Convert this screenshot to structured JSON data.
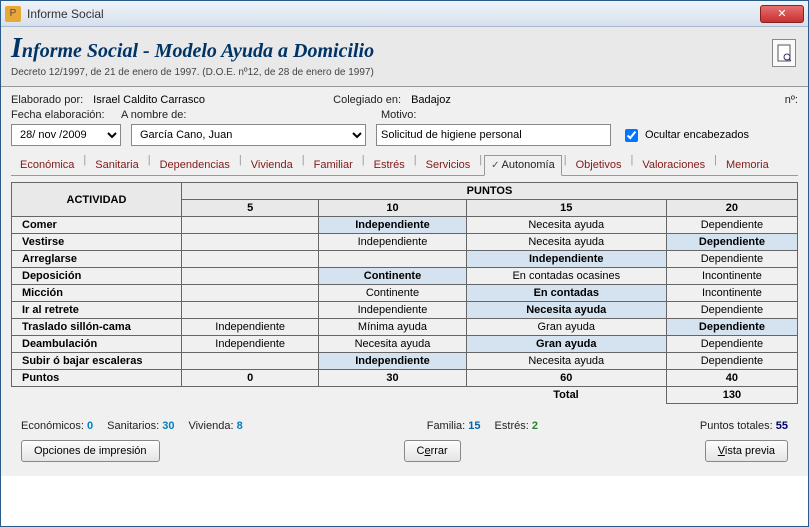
{
  "window": {
    "title": "Informe Social"
  },
  "header": {
    "title": "Informe Social - Modelo Ayuda a Domicilio",
    "subtitle": "Decreto 12/1997, de 21 de enero de 1997. (D.O.E. nº12, de 28 de enero de 1997)"
  },
  "info": {
    "elaborado_lbl": "Elaborado por:",
    "elaborado_val": "Israel Caldito Carrasco",
    "colegiado_lbl": "Colegiado en:",
    "colegiado_val": "Badajoz",
    "num_lbl": "nº:",
    "fecha_lbl": "Fecha elaboración:",
    "fecha_val": "28/ nov /2009",
    "nombre_lbl": "A nombre de:",
    "nombre_val": "García Cano, Juan",
    "motivo_lbl": "Motivo:",
    "motivo_val": "Solicitud de higiene personal",
    "ocultar_lbl": "Ocultar encabezados",
    "ocultar_checked": true
  },
  "tabs": [
    "Económica",
    "Sanitaria",
    "Dependencias",
    "Vivienda",
    "Familiar",
    "Estrés",
    "Servicios",
    "Autonomía",
    "Objetivos",
    "Valoraciones",
    "Memoria"
  ],
  "active_tab": 7,
  "grid": {
    "col_act": "ACTIVIDAD",
    "col_puntos": "PUNTOS",
    "cols": [
      "5",
      "10",
      "15",
      "20"
    ],
    "rows": [
      {
        "act": "Comer",
        "cells": [
          {
            "t": ""
          },
          {
            "t": "Independiente",
            "hi": true
          },
          {
            "t": "Necesita ayuda"
          },
          {
            "t": "Dependiente"
          }
        ]
      },
      {
        "act": "Vestirse",
        "cells": [
          {
            "t": ""
          },
          {
            "t": "Independiente"
          },
          {
            "t": "Necesita ayuda"
          },
          {
            "t": "Dependiente",
            "hi": true
          }
        ]
      },
      {
        "act": "Arreglarse",
        "cells": [
          {
            "t": ""
          },
          {
            "t": ""
          },
          {
            "t": "Independiente",
            "hi": true
          },
          {
            "t": "Dependiente"
          }
        ]
      },
      {
        "act": "Deposición",
        "cells": [
          {
            "t": ""
          },
          {
            "t": "Continente",
            "hi": true
          },
          {
            "t": "En contadas ocasines"
          },
          {
            "t": "Incontinente"
          }
        ]
      },
      {
        "act": "Micción",
        "cells": [
          {
            "t": ""
          },
          {
            "t": "Continente"
          },
          {
            "t": "En contadas",
            "hi": true
          },
          {
            "t": "Incontinente"
          }
        ]
      },
      {
        "act": "Ir al retrete",
        "cells": [
          {
            "t": ""
          },
          {
            "t": "Independiente"
          },
          {
            "t": "Necesita ayuda",
            "hi": true
          },
          {
            "t": "Dependiente"
          }
        ]
      },
      {
        "act": "Traslado sillón-cama",
        "cells": [
          {
            "t": "Independiente"
          },
          {
            "t": "Mínima ayuda"
          },
          {
            "t": "Gran ayuda"
          },
          {
            "t": "Dependiente",
            "hi": true
          }
        ]
      },
      {
        "act": "Deambulación",
        "cells": [
          {
            "t": "Independiente"
          },
          {
            "t": "Necesita ayuda"
          },
          {
            "t": "Gran ayuda",
            "hi": true
          },
          {
            "t": "Dependiente"
          }
        ]
      },
      {
        "act": "Subir ó bajar escaleras",
        "cells": [
          {
            "t": ""
          },
          {
            "t": "Independiente",
            "hi": true
          },
          {
            "t": "Necesita ayuda"
          },
          {
            "t": "Dependiente"
          }
        ]
      }
    ],
    "puntos_lbl": "Puntos",
    "puntos": [
      "0",
      "30",
      "60",
      "40"
    ],
    "total_lbl": "Total",
    "total": "130"
  },
  "footer": {
    "econ_lbl": "Económicos:",
    "econ": "0",
    "san_lbl": "Sanitarios:",
    "san": "30",
    "viv_lbl": "Vivienda:",
    "viv": "8",
    "fam_lbl": "Familia:",
    "fam": "15",
    "est_lbl": "Estrés:",
    "est": "2",
    "tot_lbl": "Puntos totales:",
    "tot": "55"
  },
  "buttons": {
    "print": "Opciones de impresión",
    "close_pre": "C",
    "close_ul": "e",
    "close_post": "rrar",
    "preview_pre": "",
    "preview_ul": "V",
    "preview_post": "ista previa"
  }
}
